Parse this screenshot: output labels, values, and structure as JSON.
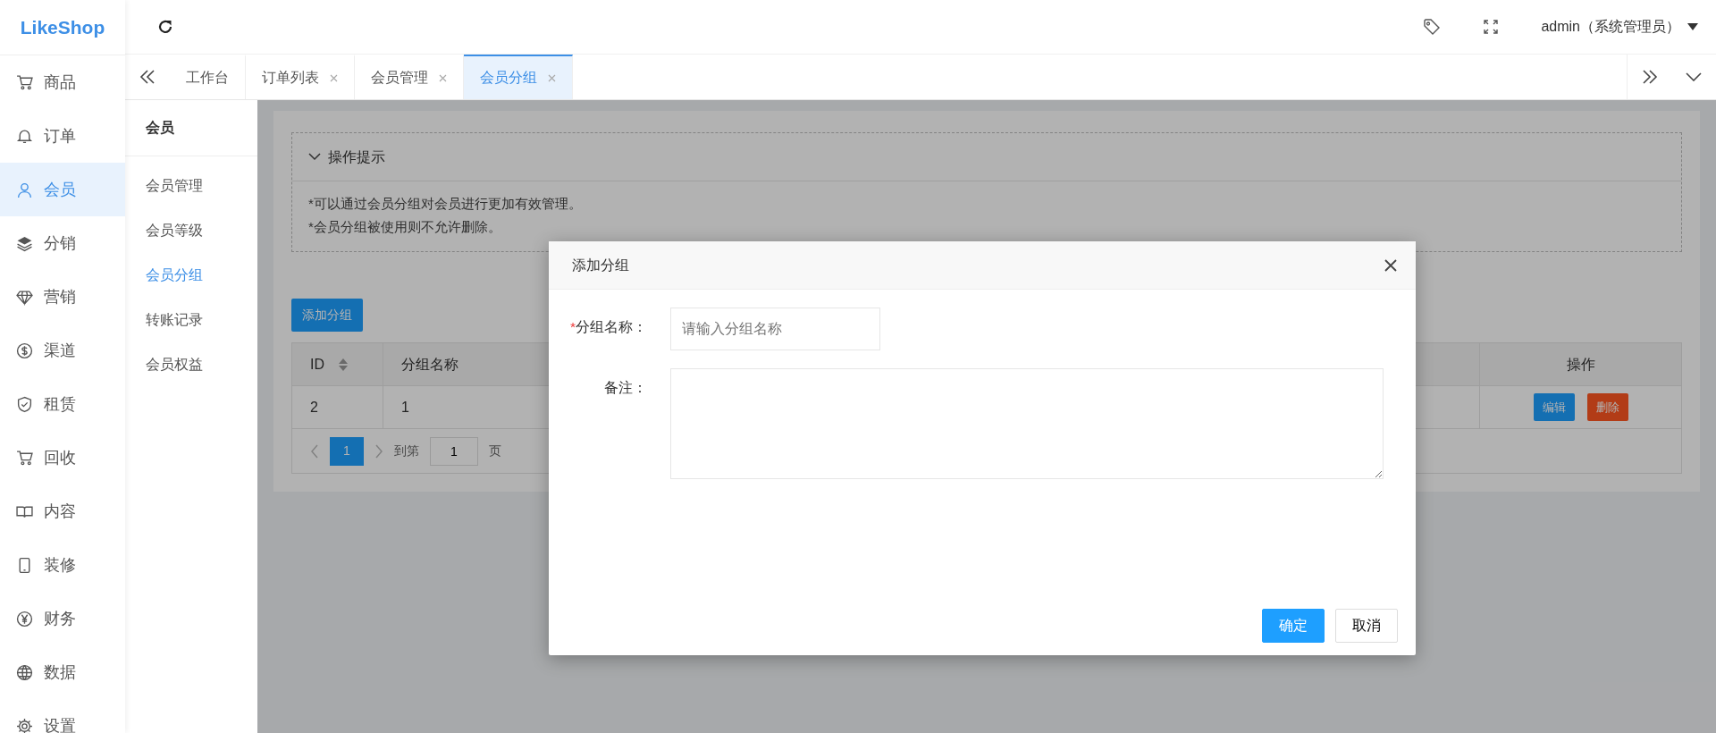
{
  "logo": "LikeShop",
  "header": {
    "user": "admin（系统管理员）"
  },
  "sidebar": {
    "items": [
      {
        "label": "商品",
        "selected": false
      },
      {
        "label": "订单",
        "selected": false
      },
      {
        "label": "会员",
        "selected": true
      },
      {
        "label": "分销",
        "selected": false
      },
      {
        "label": "营销",
        "selected": false
      },
      {
        "label": "渠道",
        "selected": false
      },
      {
        "label": "租赁",
        "selected": false
      },
      {
        "label": "回收",
        "selected": false
      },
      {
        "label": "内容",
        "selected": false
      },
      {
        "label": "装修",
        "selected": false
      },
      {
        "label": "财务",
        "selected": false
      },
      {
        "label": "数据",
        "selected": false
      },
      {
        "label": "设置",
        "selected": false
      }
    ]
  },
  "tabs": [
    {
      "label": "工作台",
      "selected": false,
      "closable": false
    },
    {
      "label": "订单列表",
      "selected": false,
      "closable": true
    },
    {
      "label": "会员管理",
      "selected": false,
      "closable": true
    },
    {
      "label": "会员分组",
      "selected": true,
      "closable": true
    }
  ],
  "submenu": {
    "title": "会员",
    "items": [
      {
        "label": "会员管理",
        "selected": false
      },
      {
        "label": "会员等级",
        "selected": false
      },
      {
        "label": "会员分组",
        "selected": true
      },
      {
        "label": "转账记录",
        "selected": false
      },
      {
        "label": "会员权益",
        "selected": false
      }
    ]
  },
  "tips": {
    "title": "操作提示",
    "expanded": true,
    "lines": [
      "*可以通过会员分组对会员进行更加有效管理。",
      "*会员分组被使用则不允许删除。"
    ]
  },
  "add_button": "添加分组",
  "table": {
    "columns": [
      "ID",
      "分组名称",
      "操作"
    ],
    "rows": [
      {
        "cells": [
          "2",
          "1"
        ],
        "actions": [
          {
            "label": "编辑",
            "kind": "edit"
          },
          {
            "label": "删除",
            "kind": "delete"
          }
        ]
      }
    ]
  },
  "pager": {
    "pages": [
      {
        "label": "1",
        "selected": true
      }
    ],
    "goto_label": "到第",
    "goto_value": "1",
    "page_label": "页"
  },
  "modal": {
    "title": "添加分组",
    "fields": [
      {
        "label": "分组名称：",
        "required_mark": "*",
        "kind": "input",
        "placeholder": "请输入分组名称"
      },
      {
        "label": "备注：",
        "kind": "textarea"
      }
    ],
    "buttons": [
      {
        "label": "确定",
        "primary": true
      },
      {
        "label": "取消",
        "primary": false
      }
    ]
  }
}
